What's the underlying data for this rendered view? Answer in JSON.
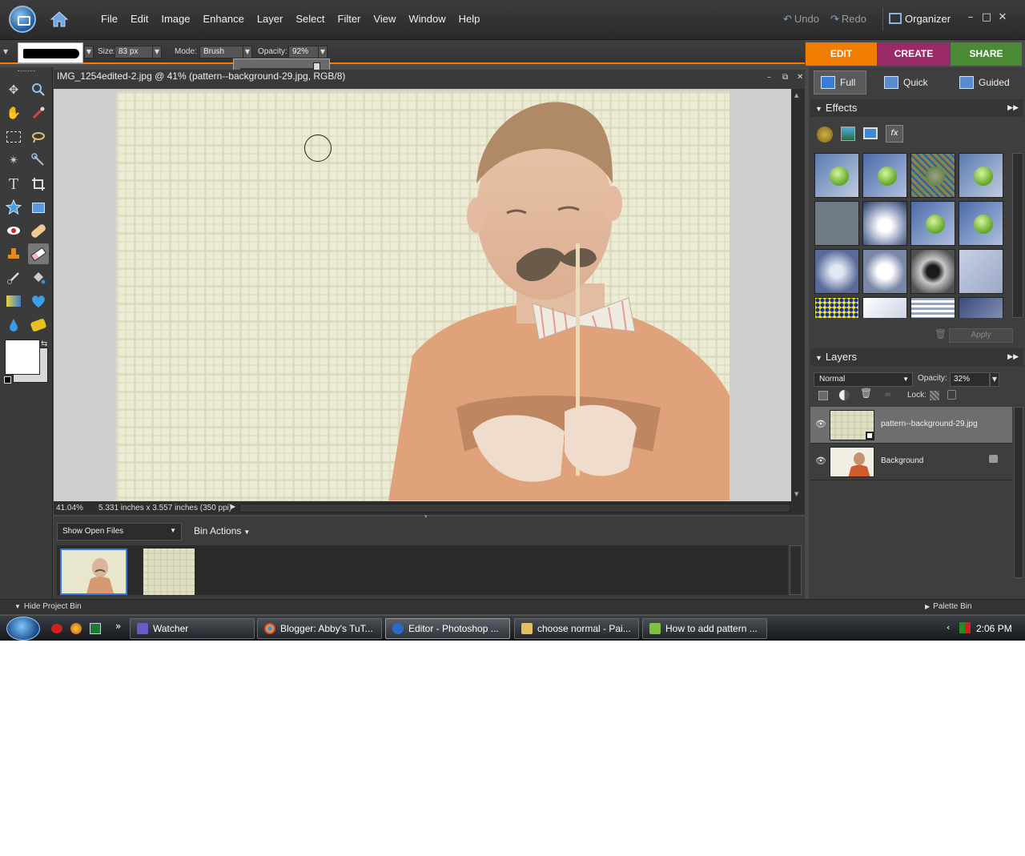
{
  "menubar": {
    "menus": [
      "File",
      "Edit",
      "Image",
      "Enhance",
      "Layer",
      "Select",
      "Filter",
      "View",
      "Window",
      "Help"
    ],
    "undo_label": "Undo",
    "redo_label": "Redo",
    "organizer_label": "Organizer"
  },
  "options": {
    "size_label": "Size:",
    "size_value": "83 px",
    "mode_label": "Mode:",
    "mode_value": "Brush",
    "opacity_label": "Opacity:",
    "opacity_value": "92%"
  },
  "mode_tabs": {
    "edit": "EDIT",
    "create": "CREATE",
    "share": "SHARE",
    "colors": {
      "edit": "#f07c00",
      "create": "#9b2a6a",
      "share": "#4a8a34"
    }
  },
  "document": {
    "title": "IMG_1254edited-2.jpg @ 41% (pattern--background-29.jpg, RGB/8)",
    "zoom": "41.04%",
    "dimensions": "5.331 inches x 3.557 inches (350 ppi)"
  },
  "project_bin": {
    "show_select": "Show Open Files",
    "bin_actions": "Bin Actions",
    "hide_label": "Hide Project Bin",
    "palette_bin_label": "Palette Bin"
  },
  "right_panel": {
    "sub_tabs": [
      "Full",
      "Quick",
      "Guided"
    ],
    "effects_title": "Effects",
    "apply_label": "Apply",
    "layers_title": "Layers",
    "blend_mode": "Normal",
    "layer_opacity_label": "Opacity:",
    "layer_opacity_value": "32%",
    "lock_label": "Lock:",
    "layers": [
      {
        "name": "pattern--background-29.jpg"
      },
      {
        "name": "Background"
      }
    ]
  },
  "taskbar": {
    "buttons": [
      "Watcher",
      "Blogger: Abby's TuT...",
      "Editor - Photoshop ...",
      "choose normal - Pai...",
      "How to add pattern ..."
    ],
    "clock": "2:06 PM"
  }
}
